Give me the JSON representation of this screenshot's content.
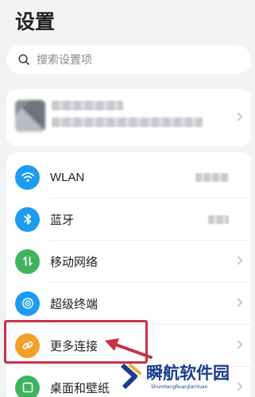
{
  "header": {
    "title": "设置"
  },
  "search": {
    "placeholder": "搜索设置项",
    "icon": "search-icon"
  },
  "account": {
    "avatar_icon": "avatar"
  },
  "settings": {
    "items": [
      {
        "label": "WLAN",
        "icon": "wifi-icon",
        "icon_color": "#1d9bf0",
        "has_value": true
      },
      {
        "label": "蓝牙",
        "icon": "bluetooth-icon",
        "icon_color": "#1d9bf0",
        "has_value": true
      },
      {
        "label": "移动网络",
        "icon": "mobile-data-icon",
        "icon_color": "#3fb35d",
        "has_value": false
      },
      {
        "label": "超级终端",
        "icon": "super-device-icon",
        "icon_color": "#1d9bf0",
        "has_value": false
      },
      {
        "label": "更多连接",
        "icon": "link-icon",
        "icon_color": "#f0a12a",
        "has_value": false
      },
      {
        "label": "桌面和壁纸",
        "icon": "wallpaper-icon",
        "icon_color": "#3fb35d",
        "has_value": false
      }
    ]
  },
  "watermark": {
    "title": "瞬航软件园",
    "subtitle": "ShunHangRuanJianYuan",
    "color": "#1b3c8c"
  },
  "annotation": {
    "color": "#c8314a"
  }
}
